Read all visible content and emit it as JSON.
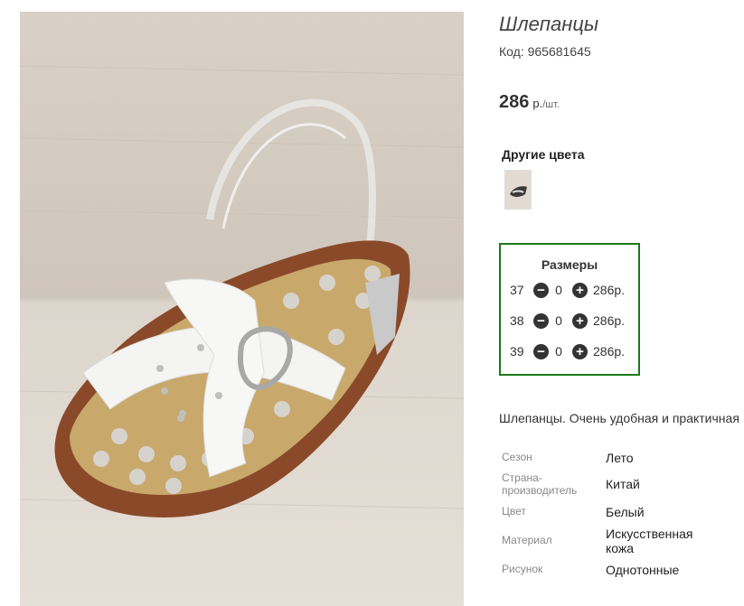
{
  "product": {
    "title": "Шлепанцы",
    "code": "Код: 965681645",
    "price_value": "286",
    "price_currency": "р.",
    "price_unit": "/шт."
  },
  "colors": {
    "title": "Другие цвета"
  },
  "sizes": {
    "title": "Размеры",
    "rows": [
      {
        "size": "37",
        "qty": "0",
        "price": "286р."
      },
      {
        "size": "38",
        "qty": "0",
        "price": "286р."
      },
      {
        "size": "39",
        "qty": "0",
        "price": "286р."
      }
    ]
  },
  "description": "Шлепанцы. Очень удобная и практичная",
  "properties": [
    {
      "key": "Сезон",
      "value": "Лето"
    },
    {
      "key": "Страна-производитель",
      "value": "Китай"
    },
    {
      "key": "Цвет",
      "value": "Белый"
    },
    {
      "key": "Материал",
      "value": "Искусственная кожа"
    },
    {
      "key": "Рисунок",
      "value": "Однотонные"
    }
  ],
  "icons": {
    "minus": "minus-circle-icon",
    "plus": "plus-circle-icon"
  }
}
